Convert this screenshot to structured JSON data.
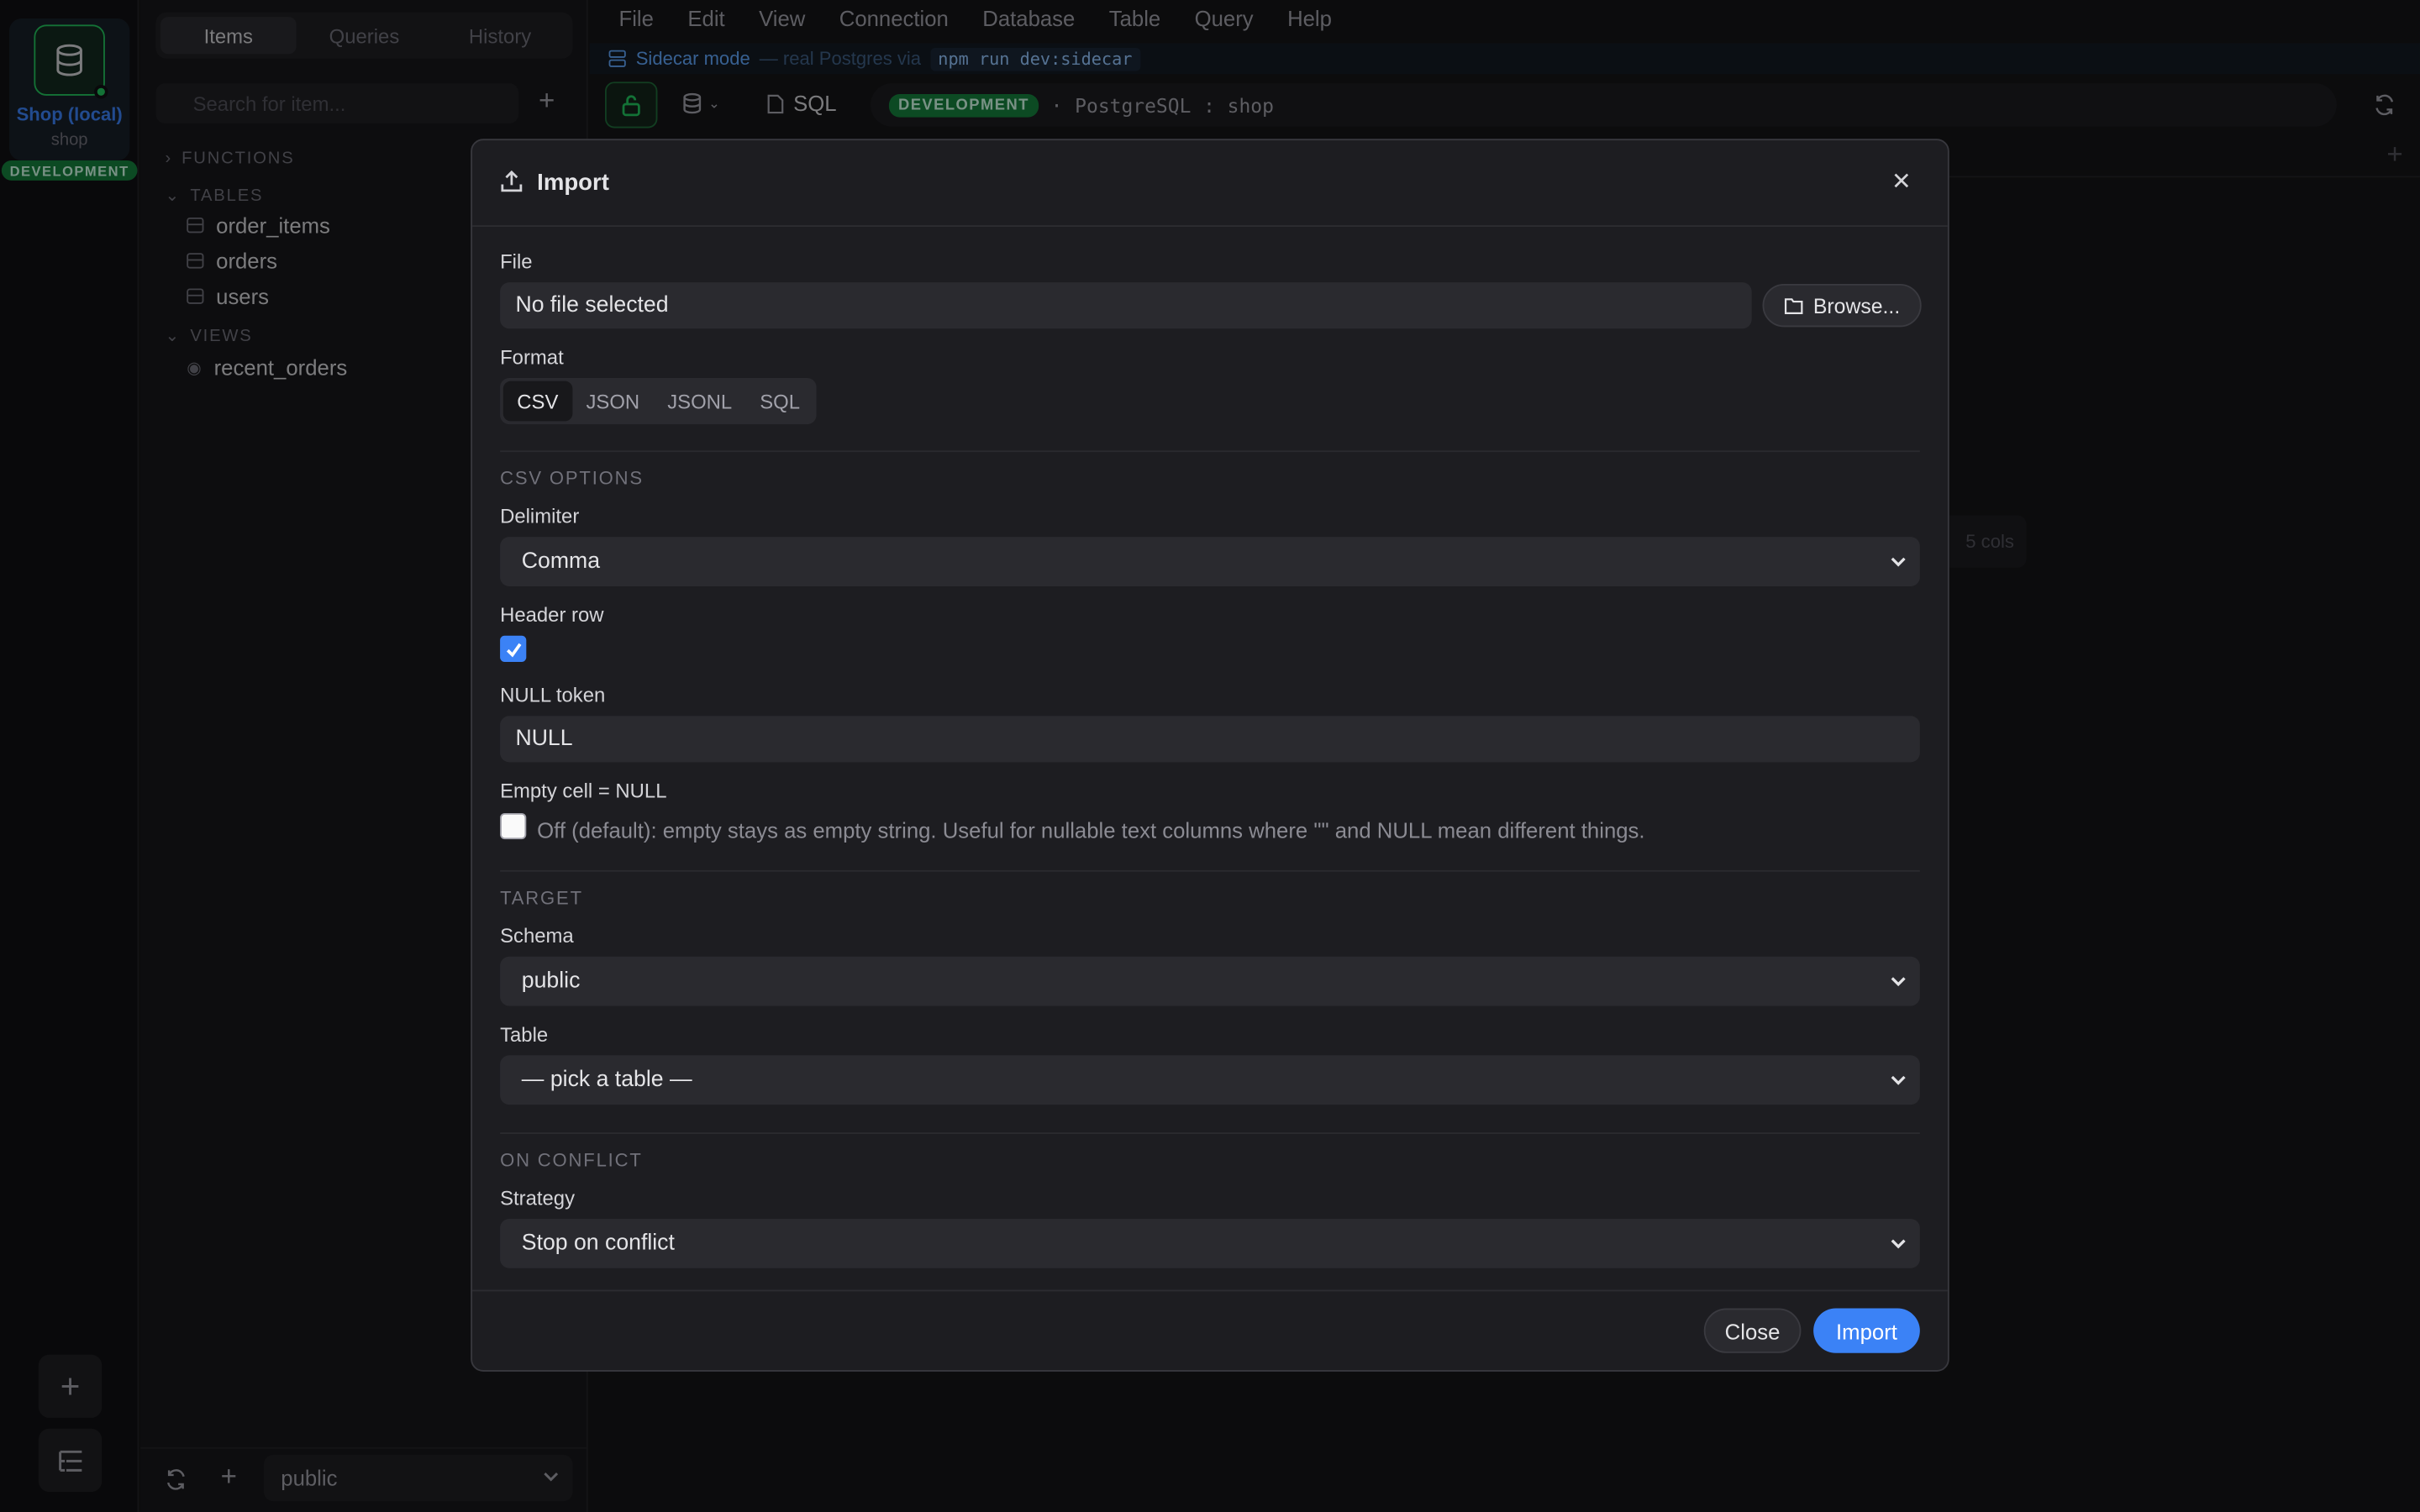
{
  "colors": {
    "accent": "#3b82f6",
    "env": "#15803d",
    "success": "#22c55e"
  },
  "rail": {
    "connection": {
      "name": "Shop (local)",
      "database": "shop",
      "environment": "DEVELOPMENT",
      "icon": "database-icon"
    },
    "add_icon": "plus-icon",
    "tree_icon": "list-tree-icon"
  },
  "sidebar": {
    "tabs": [
      "Items",
      "Queries",
      "History"
    ],
    "active_tab": "Items",
    "search_placeholder": "Search for item...",
    "groups": {
      "functions": "FUNCTIONS",
      "tables": "TABLES",
      "views": "VIEWS"
    },
    "tables": [
      "order_items",
      "orders",
      "users"
    ],
    "views": [
      "recent_orders"
    ],
    "schema": "public"
  },
  "menu": [
    "File",
    "Edit",
    "View",
    "Connection",
    "Database",
    "Table",
    "Query",
    "Help"
  ],
  "sidecar": {
    "label": "Sidecar mode",
    "note": "— real Postgres via",
    "command": "npm run dev:sidecar"
  },
  "toolbar": {
    "sql_label": "SQL",
    "env_badge": "DEVELOPMENT",
    "separator": "·",
    "engine": "PostgreSQL",
    "colon": ":",
    "database": "shop"
  },
  "background": {
    "cols_chip": "5 cols"
  },
  "dialog": {
    "title": "Import",
    "file_label": "File",
    "file_value": "No file selected",
    "browse_label": "Browse...",
    "format_label": "Format",
    "formats": [
      "CSV",
      "JSON",
      "JSONL",
      "SQL"
    ],
    "active_format": "CSV",
    "csv_section": "CSV OPTIONS",
    "delimiter_label": "Delimiter",
    "delimiter_value": "Comma",
    "header_row_label": "Header row",
    "header_row_checked": true,
    "null_token_label": "NULL token",
    "null_token_value": "NULL",
    "empty_cell_label": "Empty cell = NULL",
    "empty_cell_checked": false,
    "empty_cell_hint": "Off (default): empty stays as empty string. Useful for nullable text columns where \"\" and NULL mean different things.",
    "target_section": "TARGET",
    "schema_label": "Schema",
    "schema_value": "public",
    "table_label": "Table",
    "table_value": "— pick a table —",
    "conflict_section": "ON CONFLICT",
    "strategy_label": "Strategy",
    "strategy_value": "Stop on conflict",
    "close_label": "Close",
    "import_label": "Import"
  }
}
